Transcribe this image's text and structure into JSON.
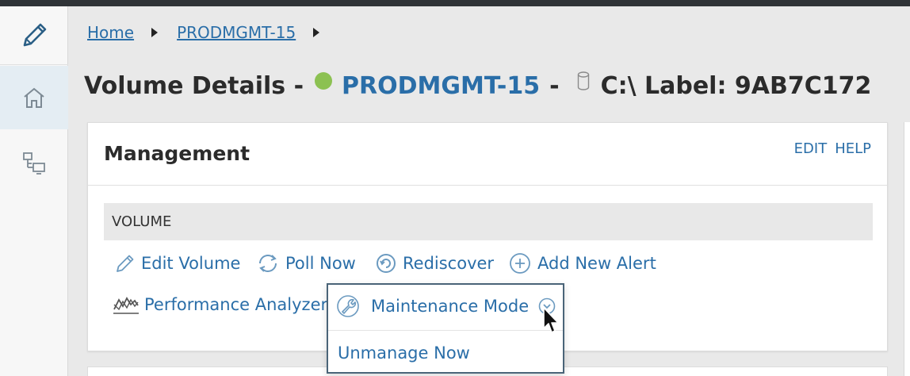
{
  "breadcrumb": {
    "home": "Home",
    "node": "PRODMGMT-15"
  },
  "page_title": {
    "prefix": "Volume Details -",
    "node": "PRODMGMT-15",
    "separator": "-",
    "volume": "C:\\ Label: 9AB7C172"
  },
  "panel": {
    "title": "Management",
    "edit": "EDIT",
    "help": "HELP",
    "section": "VOLUME"
  },
  "actions": {
    "edit_volume": "Edit Volume",
    "poll_now": "Poll Now",
    "rediscover": "Rediscover",
    "add_alert": "Add New Alert",
    "performance_analyzer": "Performance Analyzer",
    "maintenance_mode": "Maintenance Mode",
    "unmanage_now": "Unmanage Now"
  },
  "colors": {
    "link": "#2a6ea8",
    "status_up": "#8cc152",
    "section_bg": "#e8e8e8"
  },
  "icons": {
    "sidebar": [
      "pencil-icon",
      "home-icon",
      "network-icon"
    ],
    "status": "status-up-icon",
    "volume": "disk-icon"
  }
}
